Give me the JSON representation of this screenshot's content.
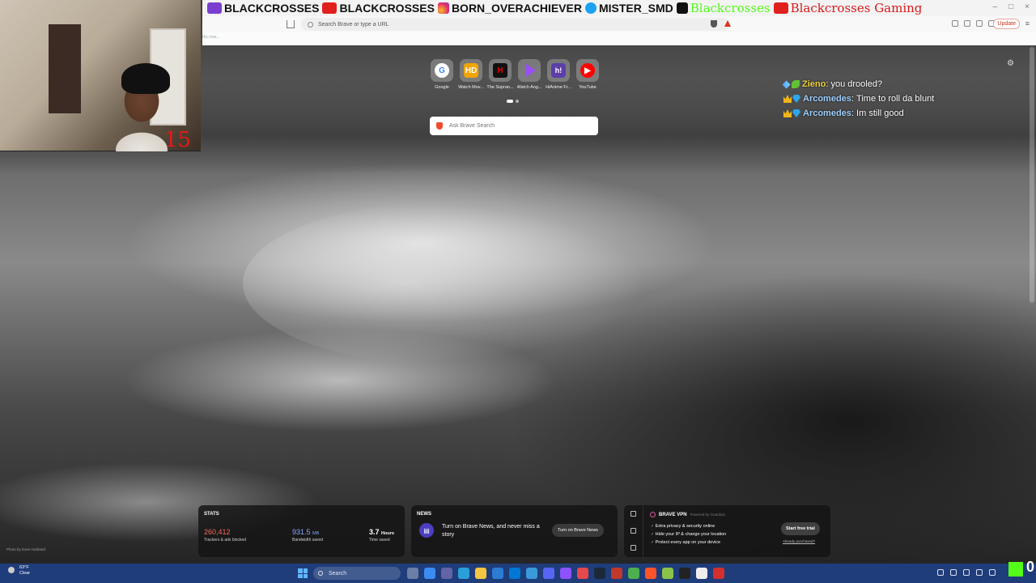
{
  "stream_banner": {
    "items": [
      {
        "icon": "twitch-icon",
        "text": "BLACKCROSSES"
      },
      {
        "icon": "youtube-icon",
        "text": "BLACKCROSSES"
      },
      {
        "icon": "instagram-icon",
        "text": "BORN_OVERACHIEVER"
      },
      {
        "icon": "twitter-icon",
        "text": "MISTER_SMD"
      },
      {
        "icon": "kick-icon",
        "text": "Blackcrosses"
      },
      {
        "icon": "youtube-icon",
        "text": "Blackcrosses Gaming"
      }
    ],
    "colors": {
      "twitch": "#7a3fd0",
      "youtube": "#e0201c",
      "kick": "#53fc18"
    }
  },
  "browser": {
    "url_placeholder": "Search Brave or type a URL",
    "update_label": "Update",
    "bookmark_hint": "rks now..."
  },
  "webcam": {
    "overlay_count": "15"
  },
  "top_sites": [
    {
      "label": "Google",
      "glyph": "G",
      "icon": "google-icon"
    },
    {
      "label": "Watch Mov...",
      "glyph": "HD",
      "icon": "hd-icon"
    },
    {
      "label": "The Sopran...",
      "glyph": "H",
      "icon": "sopranos-icon"
    },
    {
      "label": "Watch Ang...",
      "glyph": "",
      "icon": "play-icon"
    },
    {
      "label": "HiAnime Fr...",
      "glyph": "h!",
      "icon": "hianime-icon"
    },
    {
      "label": "YouTube",
      "glyph": "▶",
      "icon": "youtube-icon"
    }
  ],
  "search": {
    "placeholder": "Ask Brave Search"
  },
  "chat": [
    {
      "user": "Zieno",
      "text": "you drooled?",
      "badges": [
        "sword",
        "leaf"
      ]
    },
    {
      "user": "Arcomedes",
      "text": "Time to roll da blunt",
      "badges": [
        "crown",
        "gem"
      ]
    },
    {
      "user": "Arcomedes",
      "text": "Im still good",
      "badges": [
        "crown",
        "gem"
      ]
    }
  ],
  "stats": {
    "title": "STATS",
    "trackers": {
      "value": "260,412",
      "caption": "Trackers & ads blocked"
    },
    "bandwidth": {
      "value": "931.5",
      "unit": "MB",
      "caption": "Bandwidth saved"
    },
    "time": {
      "value": "3.7",
      "unit": "Hours",
      "caption": "Time saved"
    }
  },
  "news": {
    "title": "NEWS",
    "text": "Turn on Brave News, and never miss a story",
    "button": "Turn on Brave News"
  },
  "vpn": {
    "title": "BRAVE VPN",
    "powered": "Powered by Guardian",
    "features": [
      "Extra privacy & security online",
      "Hide your IP & change your location",
      "Protect every app on your device"
    ],
    "button": "Start free trial",
    "already": "Already purchased?"
  },
  "photo_credit": "Photo by Dave Hubbard",
  "taskbar": {
    "weather_temp": "63°F",
    "weather_desc": "Clear",
    "search_placeholder": "Search",
    "corner_number": "0"
  }
}
